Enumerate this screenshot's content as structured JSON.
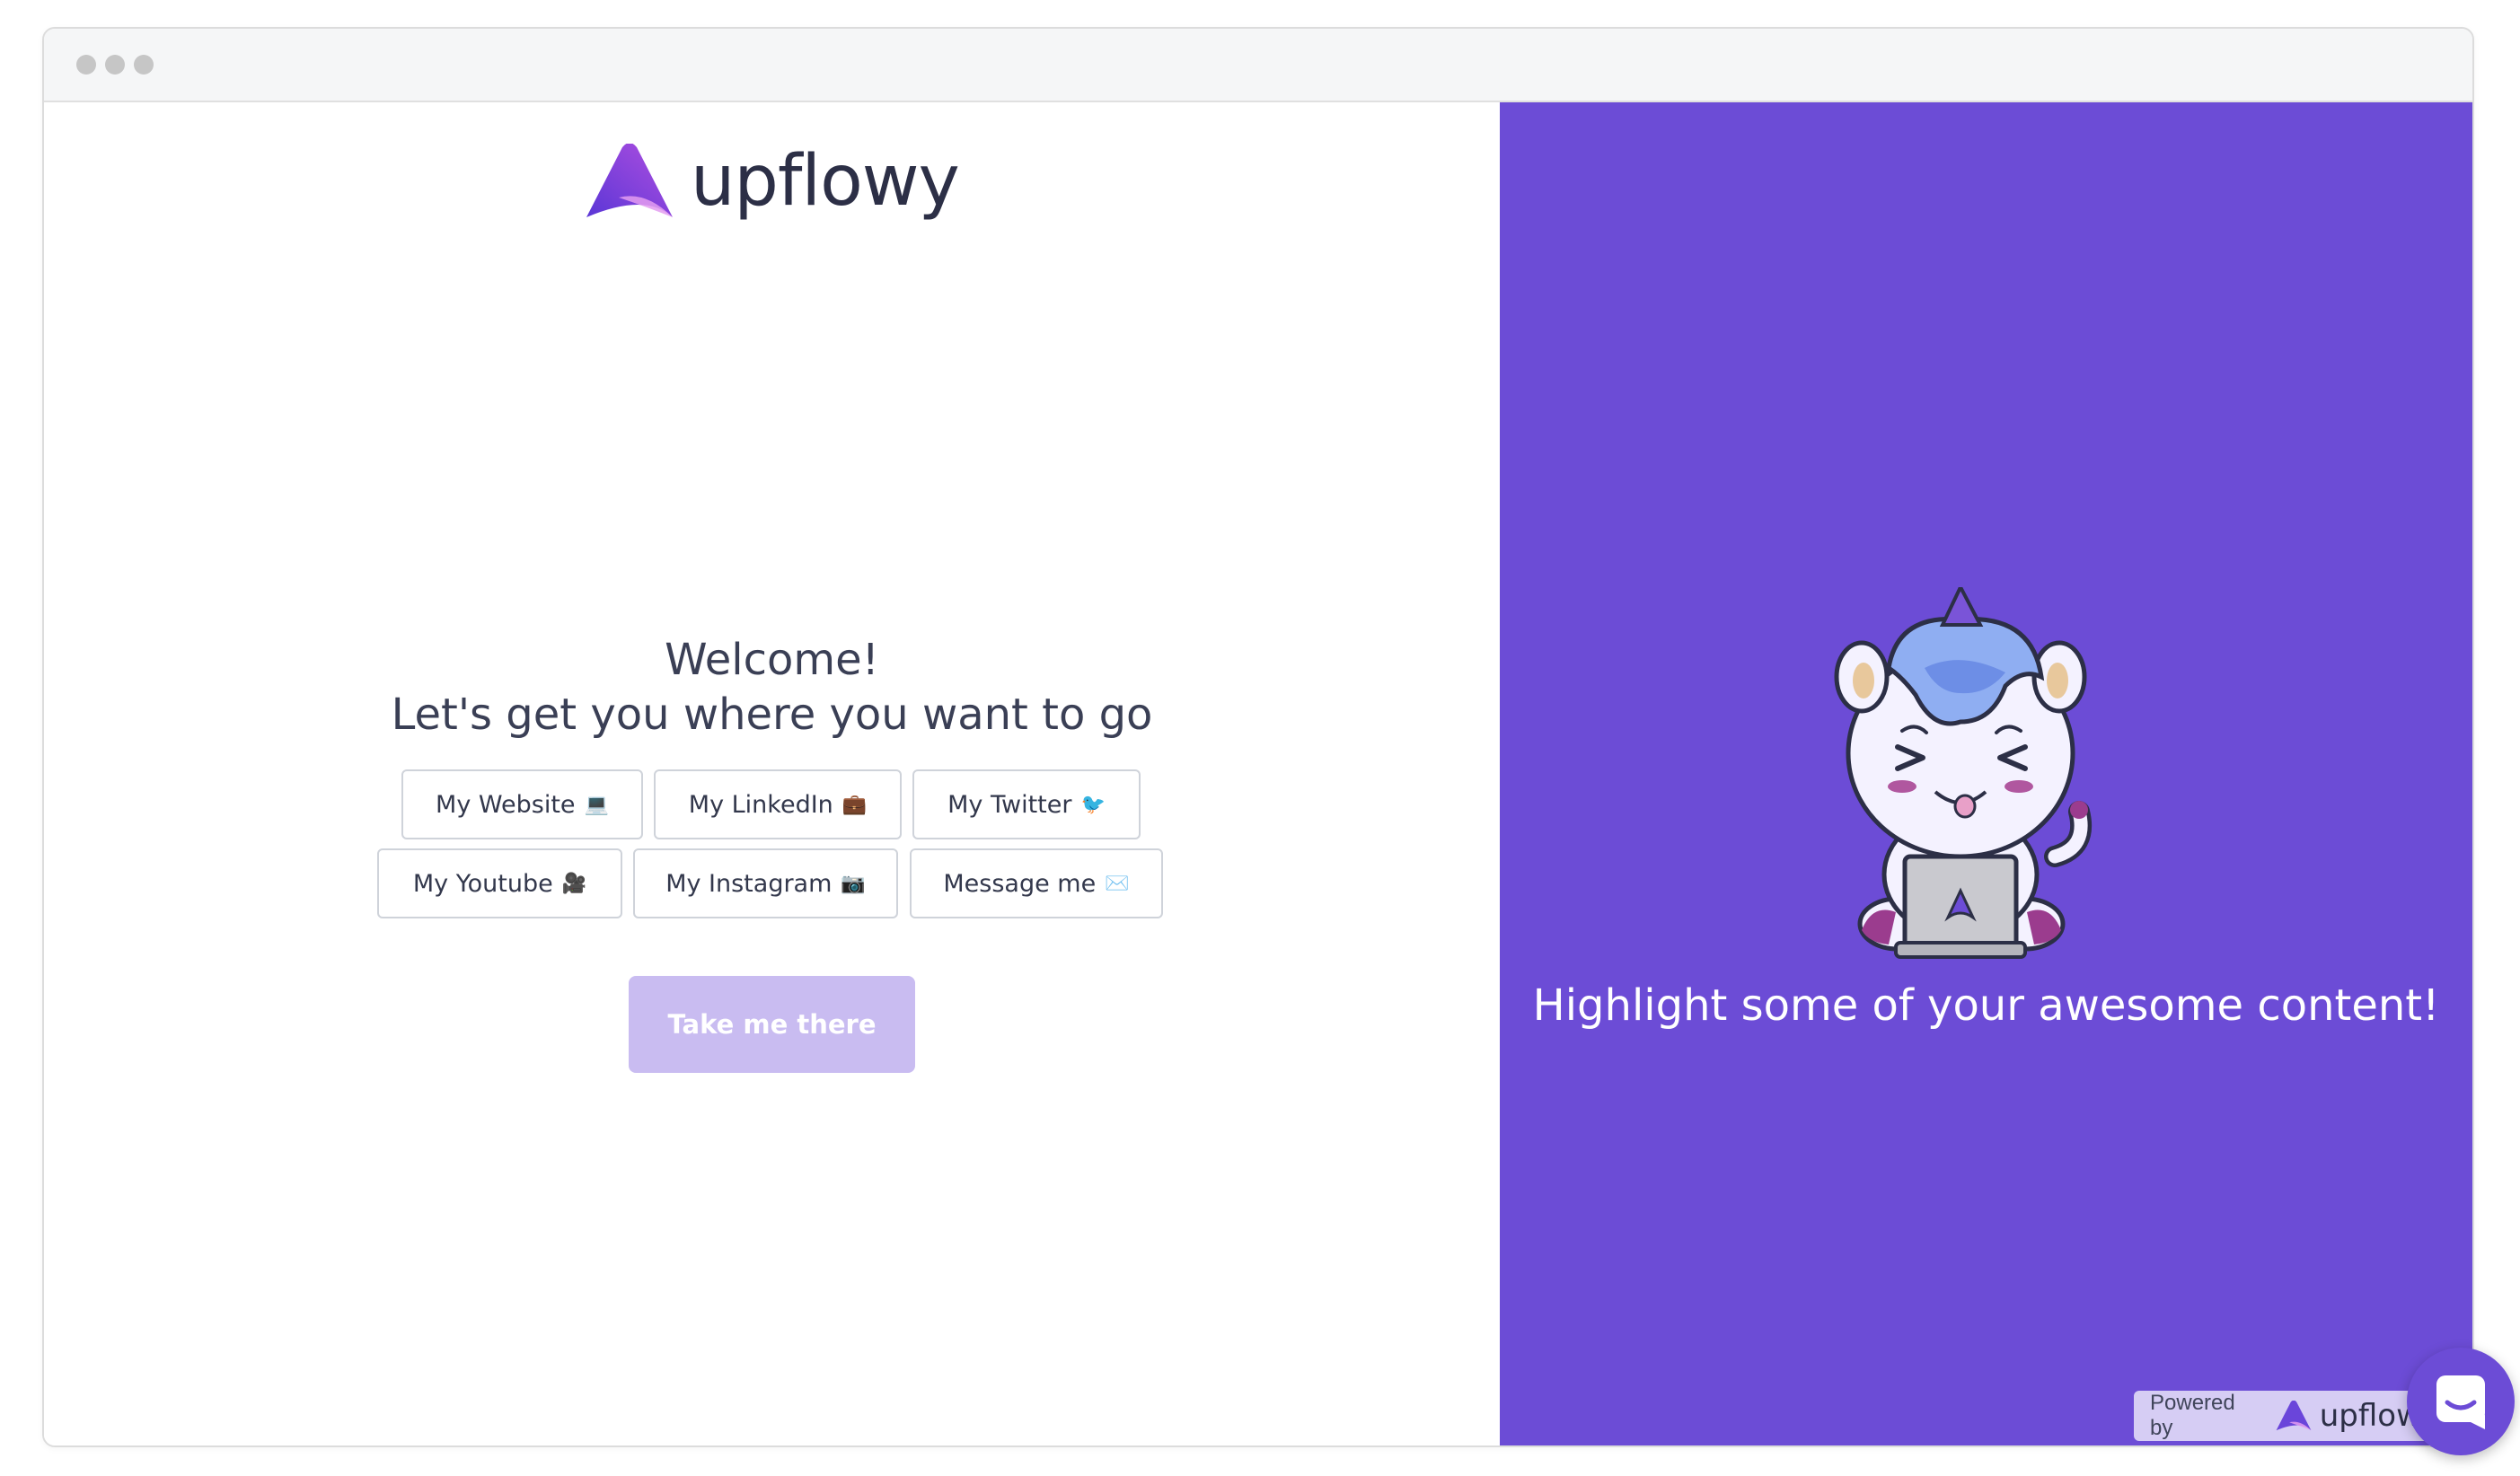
{
  "brand": {
    "name": "upflowy",
    "accent_color": "#6c4cd6",
    "logo_icon": "upflowy-logo-icon"
  },
  "left_panel": {
    "welcome": "Welcome!",
    "subtitle": "Let's get you where you want to go",
    "options": [
      {
        "label": "My Website",
        "emoji": "💻"
      },
      {
        "label": "My LinkedIn",
        "emoji": "💼"
      },
      {
        "label": "My Twitter",
        "emoji": "🐦"
      },
      {
        "label": "My Youtube",
        "emoji": "🎥"
      },
      {
        "label": "My Instagram",
        "emoji": "📷"
      },
      {
        "label": "Message me",
        "emoji": "✉️"
      }
    ],
    "cta_label": "Take me there"
  },
  "right_panel": {
    "background_color": "#6c4cd6",
    "illustration": "unicorn-laptop-illustration",
    "highlight_text": "Highlight some of your awesome content!"
  },
  "powered_by": {
    "label": "Powered by",
    "brand": "upflowy"
  },
  "chat_widget": {
    "icon": "chat-icon"
  }
}
